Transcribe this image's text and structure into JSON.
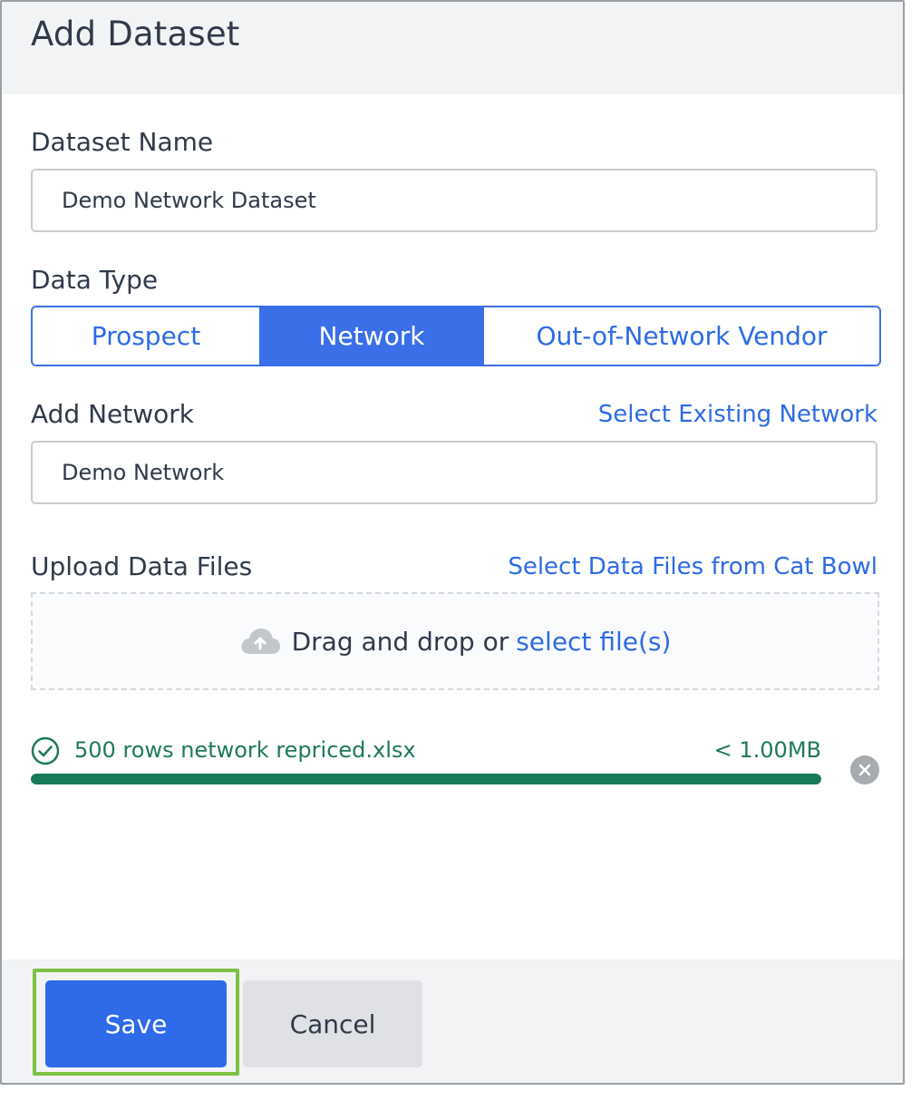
{
  "dialog": {
    "title": "Add Dataset"
  },
  "dataset_name": {
    "label": "Dataset Name",
    "value": "Demo Network Dataset"
  },
  "data_type": {
    "label": "Data Type",
    "options": [
      "Prospect",
      "Network",
      "Out-of-Network Vendor"
    ],
    "selected": "Network"
  },
  "add_network": {
    "label": "Add Network",
    "link": "Select Existing Network",
    "value": "Demo Network"
  },
  "upload": {
    "label": "Upload Data Files",
    "link": "Select Data Files from Cat Bowl",
    "drop_text": "Drag and drop or",
    "select_text": "select file(s)",
    "icon": "cloud-upload-icon"
  },
  "file": {
    "name": "500 rows network repriced.xlsx",
    "size": "< 1.00MB",
    "progress": 1.0,
    "status_icon": "check-circle-icon",
    "remove_icon": "close-circle-icon"
  },
  "footer": {
    "save_label": "Save",
    "cancel_label": "Cancel"
  },
  "colors": {
    "accent": "#3a6fe8",
    "success": "#177a58",
    "highlight": "#7dc242"
  }
}
